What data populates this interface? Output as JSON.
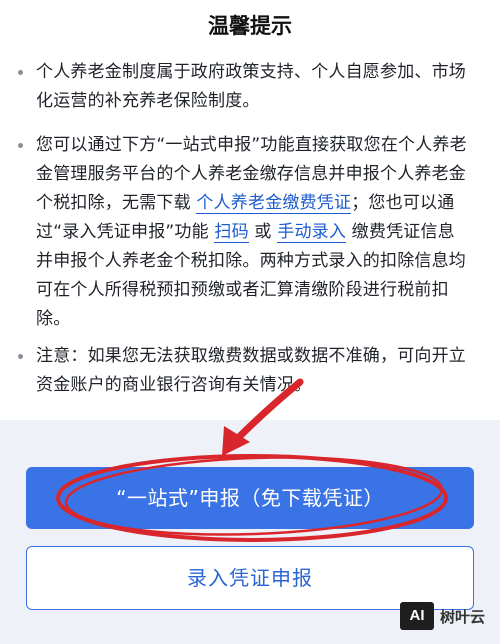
{
  "title": "温馨提示",
  "para1": {
    "lines": [
      "个人养老金制度属于政府政策支持、个人自愿参加、市场",
      "化运营的补充养老保险制度。"
    ]
  },
  "para2": {
    "line1": "您可以通过下方“一站式申报”功能直接获取您在个人养老",
    "line2": "金管理服务平台的个人养老金缴存信息并申报个人养老金",
    "line3_pre": "个税扣除，无需下载 ",
    "link_certificate": "个人养老金缴费凭证",
    "line3_post": "；您也可以通",
    "line4_pre": "过“录入凭证申报”功能 ",
    "link_scan": "扫码",
    "line4_mid": " 或 ",
    "link_manual": "手动录入",
    "line4_post": " 缴费凭证信息",
    "line5": "并申报个人养老金个税扣除。两种方式录入的扣除信息均",
    "line6": "可在个人所得税预扣预缴或者汇算清缴阶段进行税前扣",
    "line7": "除。"
  },
  "para3": {
    "lines": [
      "注意：如果您无法获取缴费数据或数据不准确，可向开立",
      "资金账户的商业银行咨询有关情况。"
    ]
  },
  "buttons": {
    "primary": "“一站式”申报（免下载凭证）",
    "secondary": "录入凭证申报"
  },
  "watermark": {
    "badge": "AI",
    "text": "树叶云"
  },
  "colors": {
    "accent": "#3a73e6",
    "link": "#1d5ccf",
    "annotation": "#d9262c",
    "bottom_bg": "#eef1f7"
  }
}
